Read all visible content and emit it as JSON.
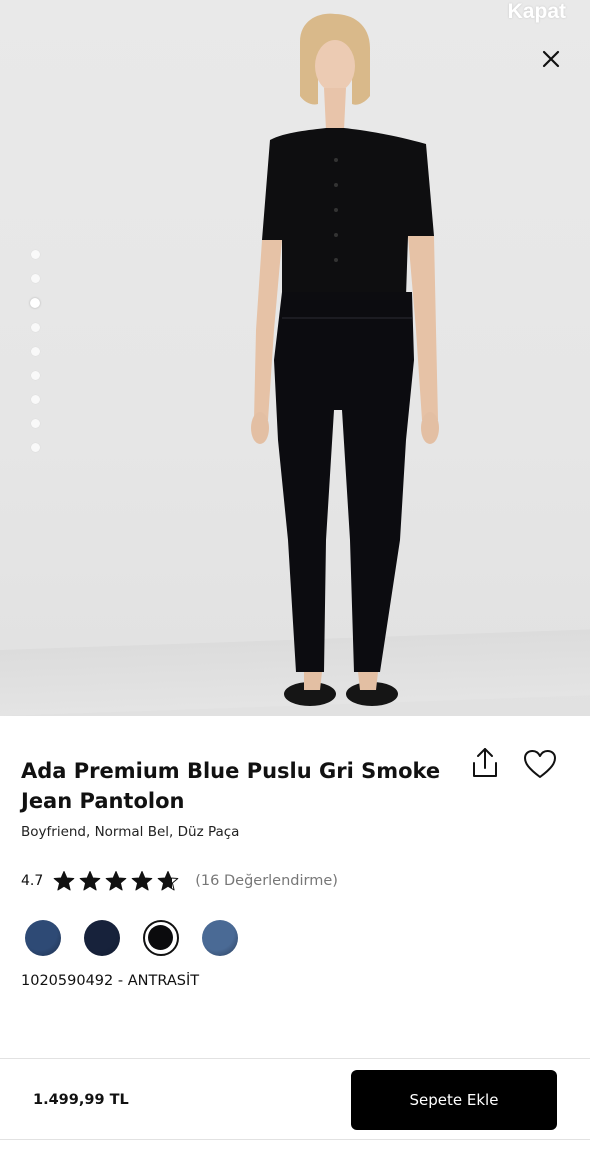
{
  "header": {
    "close_text": "Kapat"
  },
  "gallery": {
    "dot_count": 9,
    "active_index": 2
  },
  "product": {
    "title": "Ada Premium Blue Puslu Gri Smoke Jean Pantolon",
    "subtitle": "Boyfriend, Normal Bel, Düz Paça",
    "rating": "4.7",
    "rating_value": 4.7,
    "stars_max": 5,
    "review_count": "(16 Değerlendirme)",
    "sku": "1020590492 - ANTRASİT",
    "colors": [
      {
        "hex": "#2e4a75",
        "selected": false
      },
      {
        "hex": "#17223b",
        "selected": false
      },
      {
        "hex": "#0b0b0d",
        "selected": true
      },
      {
        "hex": "#4a6a95",
        "selected": false
      }
    ]
  },
  "bottom_bar": {
    "price": "1.499,99 TL",
    "add_to_cart_label": "Sepete Ekle"
  },
  "icons": {
    "close": "close-icon",
    "share": "share-icon",
    "favorite": "heart-icon",
    "star": "star-icon"
  },
  "colors": {
    "text": "#111111",
    "muted": "#777777",
    "button": "#000000",
    "background_hero": "#e6e6e6"
  }
}
